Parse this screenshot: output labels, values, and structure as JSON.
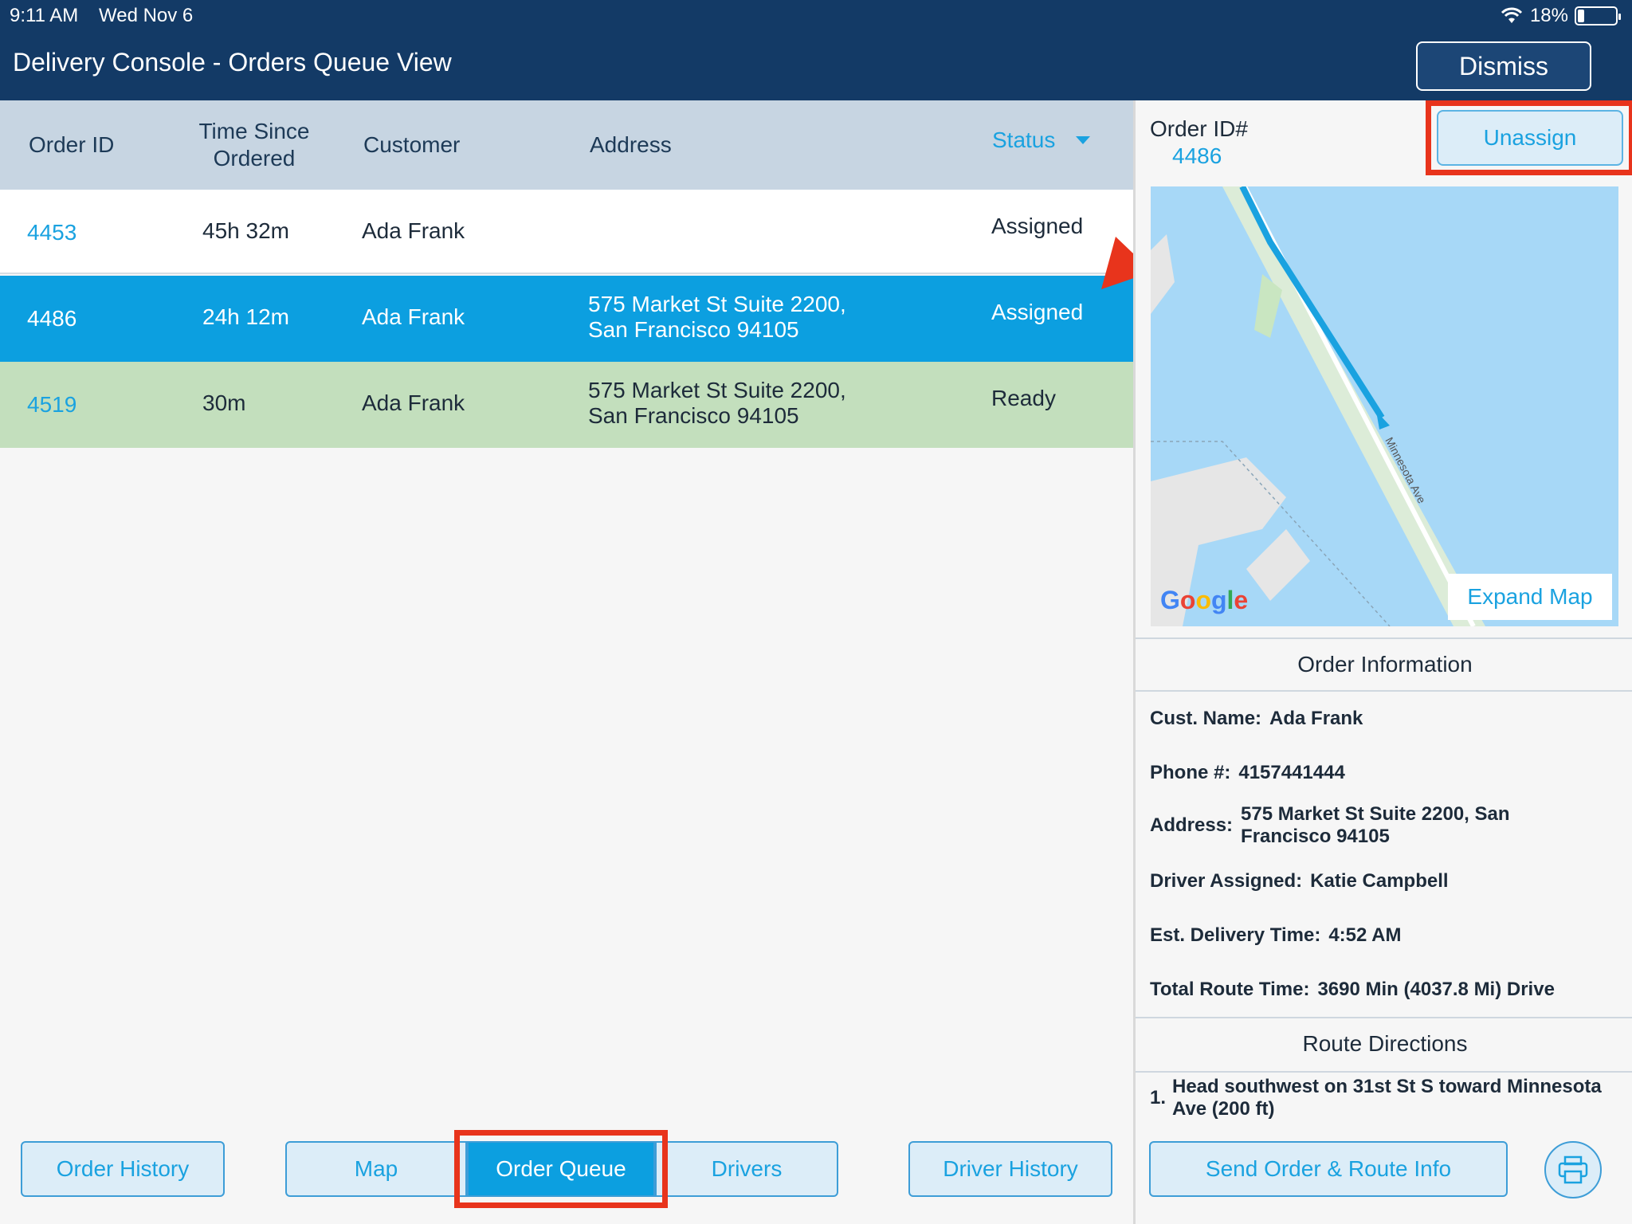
{
  "status_bar": {
    "time": "9:11 AM",
    "date": "Wed Nov 6",
    "battery": "18%"
  },
  "header": {
    "title": "Delivery Console - Orders Queue View",
    "dismiss_label": "Dismiss"
  },
  "table": {
    "columns": {
      "order_id": "Order ID",
      "time_since": "Time Since Ordered",
      "customer": "Customer",
      "address": "Address",
      "status": "Status"
    },
    "rows": [
      {
        "order_id": "4453",
        "time": "45h 32m",
        "customer": "Ada Frank",
        "address_line1": "",
        "address_line2": "",
        "status": "Assigned"
      },
      {
        "order_id": "4486",
        "time": "24h 12m",
        "customer": "Ada Frank",
        "address_line1": "575 Market St Suite 2200,",
        "address_line2": "San Francisco 94105",
        "status": "Assigned"
      },
      {
        "order_id": "4519",
        "time": "30m",
        "customer": "Ada Frank",
        "address_line1": "575 Market St Suite 2200,",
        "address_line2": "San Francisco 94105",
        "status": "Ready"
      }
    ]
  },
  "detail": {
    "order_id_label": "Order ID#",
    "order_id": "4486",
    "unassign_label": "Unassign",
    "map": {
      "street_label": "Minnesota Ave",
      "expand_label": "Expand Map",
      "google_logo": "Google"
    },
    "order_info_title": "Order Information",
    "cust_name_label": "Cust. Name:",
    "cust_name": "Ada Frank",
    "phone_label": "Phone #:",
    "phone": "4157441444",
    "address_label": "Address:",
    "address": "575 Market St Suite 2200, San Francisco 94105",
    "driver_label": "Driver Assigned:",
    "driver": "Katie Campbell",
    "est_label": "Est. Delivery Time:",
    "est": "4:52 AM",
    "total_label": "Total Route Time:",
    "total": "3690 Min (4037.8 Mi) Drive",
    "route_title": "Route Directions",
    "route_steps": [
      {
        "num": "1.",
        "text": "Head southwest on 31st St S toward Minnesota Ave (200 ft)"
      }
    ]
  },
  "bottom": {
    "order_history": "Order History",
    "map": "Map",
    "order_queue": "Order Queue",
    "drivers": "Drivers",
    "driver_history": "Driver History",
    "send_info": "Send Order & Route Info"
  },
  "colors": {
    "header_bg": "#133a66",
    "accent": "#1aa2e0",
    "selected_row": "#0c9fe0",
    "ready_row": "#c3dfbd",
    "highlight": "#e8341c"
  }
}
